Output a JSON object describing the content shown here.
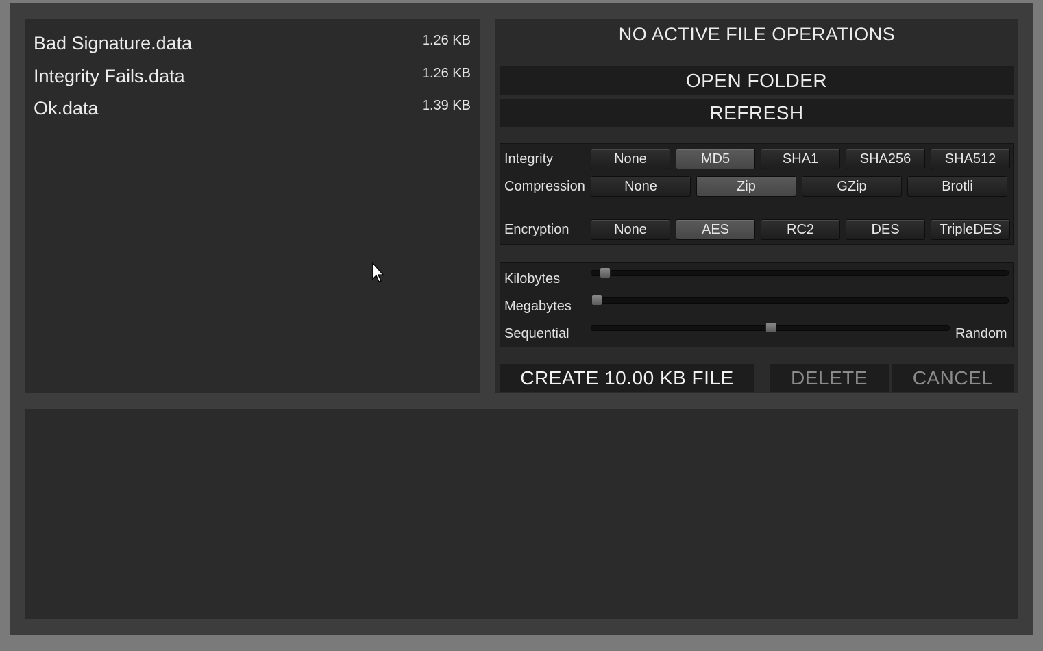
{
  "files": [
    {
      "name": "Bad Signature.data",
      "size": "1.26 KB"
    },
    {
      "name": "Integrity Fails.data",
      "size": "1.26 KB"
    },
    {
      "name": "Ok.data",
      "size": "1.39 KB"
    }
  ],
  "status": "NO ACTIVE FILE OPERATIONS",
  "buttons": {
    "open_folder": "OPEN FOLDER",
    "refresh": "REFRESH",
    "create": "CREATE 10.00 KB FILE",
    "delete": "DELETE",
    "cancel": "CANCEL"
  },
  "options": {
    "integrity": {
      "label": "Integrity",
      "choices": [
        "None",
        "MD5",
        "SHA1",
        "SHA256",
        "SHA512"
      ],
      "selected": "MD5"
    },
    "compression": {
      "label": "Compression",
      "choices": [
        "None",
        "Zip",
        "GZip",
        "Brotli"
      ],
      "selected": "Zip"
    },
    "encryption": {
      "label": "Encryption",
      "choices": [
        "None",
        "AES",
        "RC2",
        "DES",
        "TripleDES"
      ],
      "selected": "AES"
    }
  },
  "sliders": {
    "kilobytes": {
      "label": "Kilobytes",
      "value": 0.02
    },
    "megabytes": {
      "label": "Megabytes",
      "value": 0.0
    },
    "sequential": {
      "label": "Sequential",
      "right_label": "Random",
      "value": 0.5
    }
  },
  "colors": {
    "background": "#7a7a7a",
    "window": "#3d3d3d",
    "panel": "#2b2b2b",
    "button": "#1d1d1d",
    "selected_option": "#515151",
    "disabled_text": "#8a8a8a"
  },
  "cursor": "mouse-pointer-icon"
}
